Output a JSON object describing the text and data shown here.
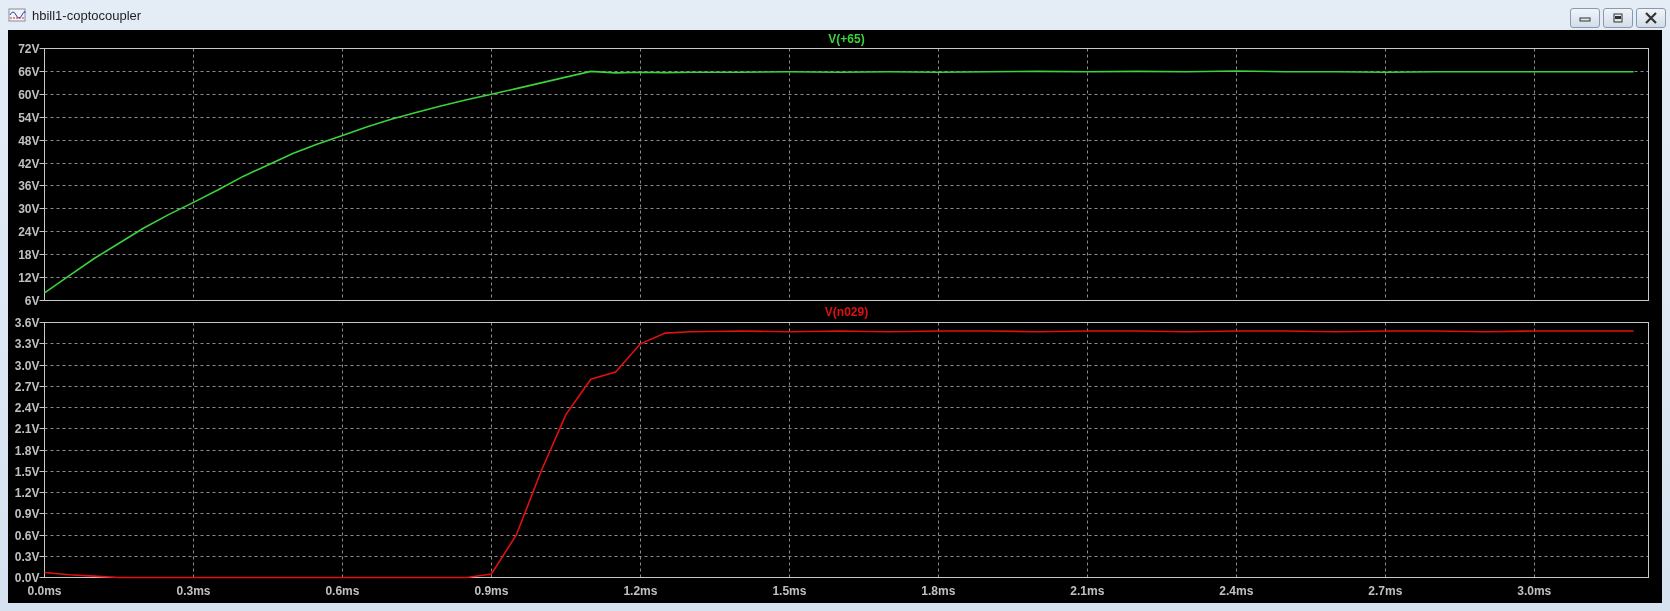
{
  "window": {
    "title": "hbill1-coptocoupler",
    "buttons": [
      {
        "kind": "minimize"
      },
      {
        "kind": "maximize"
      },
      {
        "kind": "close"
      }
    ]
  },
  "plots": [
    {
      "chart_data": {
        "type": "line",
        "grid": true,
        "xlim": [
          0,
          3.23
        ],
        "ylim": [
          6,
          72
        ],
        "yticks": [
          {
            "value": 6,
            "label": "6V"
          },
          {
            "value": 12,
            "label": "12V"
          },
          {
            "value": 18,
            "label": "18V"
          },
          {
            "value": 24,
            "label": "24V"
          },
          {
            "value": 30,
            "label": "30V"
          },
          {
            "value": 36,
            "label": "36V"
          },
          {
            "value": 42,
            "label": "42V"
          },
          {
            "value": 48,
            "label": "48V"
          },
          {
            "value": 54,
            "label": "54V"
          },
          {
            "value": 60,
            "label": "60V"
          },
          {
            "value": 66,
            "label": "66V"
          },
          {
            "value": 72,
            "label": "72V"
          }
        ],
        "x": [
          0,
          0.05,
          0.1,
          0.15,
          0.2,
          0.25,
          0.3,
          0.35,
          0.4,
          0.45,
          0.5,
          0.55,
          0.6,
          0.65,
          0.7,
          0.75,
          0.8,
          0.85,
          0.9,
          0.95,
          1.0,
          1.05,
          1.1,
          1.15,
          1.2,
          1.25,
          1.3,
          1.4,
          1.5,
          1.6,
          1.7,
          1.8,
          1.9,
          2.0,
          2.1,
          2.2,
          2.3,
          2.4,
          2.5,
          2.6,
          2.7,
          2.8,
          2.9,
          3.0,
          3.1,
          3.2
        ],
        "series": [
          {
            "name": "V(+65)",
            "color": "#3cd23c",
            "values": [
              8,
              12.5,
              17,
              21,
              25,
              28.5,
              31.7,
              35,
              38.5,
              41.5,
              44.5,
              47,
              49.2,
              51.5,
              53.5,
              55.3,
              57,
              58.6,
              60,
              61.5,
              63,
              64.5,
              66,
              65.6,
              65.8,
              65.7,
              65.8,
              65.8,
              65.9,
              65.8,
              65.9,
              65.8,
              65.9,
              66,
              65.9,
              66,
              65.9,
              66.1,
              65.9,
              65.9,
              65.8,
              65.9,
              65.9,
              65.9,
              65.9,
              65.9
            ]
          }
        ]
      }
    },
    {
      "chart_data": {
        "type": "line",
        "grid": true,
        "xlim": [
          0,
          3.23
        ],
        "ylim": [
          0,
          3.6
        ],
        "xticks": [
          {
            "value": 0,
            "label": "0.0ms"
          },
          {
            "value": 0.3,
            "label": "0.3ms"
          },
          {
            "value": 0.6,
            "label": "0.6ms"
          },
          {
            "value": 0.9,
            "label": "0.9ms"
          },
          {
            "value": 1.2,
            "label": "1.2ms"
          },
          {
            "value": 1.5,
            "label": "1.5ms"
          },
          {
            "value": 1.8,
            "label": "1.8ms"
          },
          {
            "value": 2.1,
            "label": "2.1ms"
          },
          {
            "value": 2.4,
            "label": "2.4ms"
          },
          {
            "value": 2.7,
            "label": "2.7ms"
          },
          {
            "value": 3.0,
            "label": "3.0ms"
          }
        ],
        "yticks": [
          {
            "value": 0,
            "label": "0.0V"
          },
          {
            "value": 0.3,
            "label": "0.3V"
          },
          {
            "value": 0.6,
            "label": "0.6V"
          },
          {
            "value": 0.9,
            "label": "0.9V"
          },
          {
            "value": 1.2,
            "label": "1.2V"
          },
          {
            "value": 1.5,
            "label": "1.5V"
          },
          {
            "value": 1.8,
            "label": "1.8V"
          },
          {
            "value": 2.1,
            "label": "2.1V"
          },
          {
            "value": 2.4,
            "label": "2.4V"
          },
          {
            "value": 2.7,
            "label": "2.7V"
          },
          {
            "value": 3.0,
            "label": "3.0V"
          },
          {
            "value": 3.3,
            "label": "3.3V"
          },
          {
            "value": 3.6,
            "label": "3.6V"
          }
        ],
        "x": [
          0,
          0.05,
          0.1,
          0.15,
          0.2,
          0.25,
          0.3,
          0.35,
          0.4,
          0.45,
          0.5,
          0.55,
          0.6,
          0.65,
          0.7,
          0.75,
          0.8,
          0.85,
          0.9,
          0.95,
          1.0,
          1.05,
          1.1,
          1.15,
          1.2,
          1.25,
          1.3,
          1.4,
          1.5,
          1.6,
          1.7,
          1.8,
          1.9,
          2.0,
          2.1,
          2.2,
          2.3,
          2.4,
          2.5,
          2.6,
          2.7,
          2.8,
          2.9,
          3.0,
          3.1,
          3.2
        ],
        "series": [
          {
            "name": "V(n029)",
            "color": "#e01010",
            "values": [
              0.07,
              0.04,
              0.02,
              0,
              0,
              0,
              0,
              0,
              0,
              0,
              0,
              0,
              0,
              0,
              0,
              0,
              0,
              0,
              0.05,
              0.6,
              1.5,
              2.3,
              2.8,
              2.9,
              3.3,
              3.45,
              3.47,
              3.48,
              3.47,
              3.48,
              3.47,
              3.48,
              3.48,
              3.47,
              3.48,
              3.48,
              3.47,
              3.48,
              3.48,
              3.47,
              3.48,
              3.48,
              3.47,
              3.48,
              3.48,
              3.48
            ]
          }
        ]
      }
    }
  ]
}
